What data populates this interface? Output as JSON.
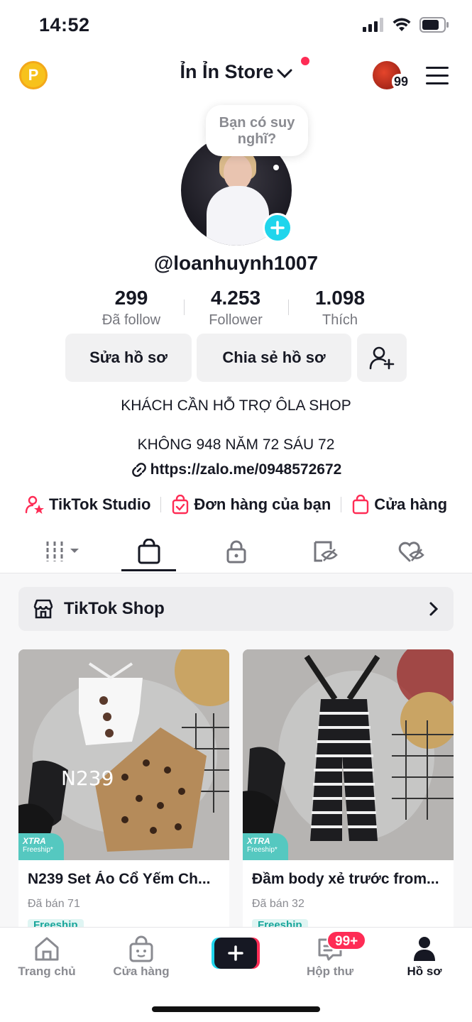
{
  "status": {
    "time": "14:52"
  },
  "header": {
    "store_name": "Ỉn Ỉn Store",
    "avatar_count": "99"
  },
  "profile": {
    "bubble_text": "Bạn có suy nghĩ?",
    "username": "@loanhuynh1007",
    "stats": [
      {
        "value": "299",
        "label": "Đã follow"
      },
      {
        "value": "4.253",
        "label": "Follower"
      },
      {
        "value": "1.098",
        "label": "Thích"
      }
    ],
    "buttons": {
      "edit": "Sửa hồ sơ",
      "share": "Chia sẻ hồ sơ"
    },
    "bio_line1": "KHÁCH CẦN HỖ TRỢ ÔLA SHOP",
    "bio_line2": "KHÔNG 948 NĂM 72 SÁU 72",
    "link": "https://zalo.me/0948572672"
  },
  "quick_links": {
    "studio": "TikTok Studio",
    "orders": "Đơn hàng của bạn",
    "shop": "Cửa hàng"
  },
  "shop": {
    "bar_label": "TikTok Shop",
    "xtra": "XTRA",
    "xtra_sub": "Freeship*",
    "products": [
      {
        "title": "N239 Set Áo Cổ Yếm Ch...",
        "sold": "Đã bán 71",
        "tag": "Freeship",
        "image_label": "N239"
      },
      {
        "title": "Đầm body xẻ trước from...",
        "sold": "Đã bán 32",
        "tag": "Freeship"
      }
    ]
  },
  "nav": {
    "home": "Trang chủ",
    "shop": "Cửa hàng",
    "inbox": "Hộp thư",
    "inbox_badge": "99+",
    "profile": "Hồ sơ"
  }
}
